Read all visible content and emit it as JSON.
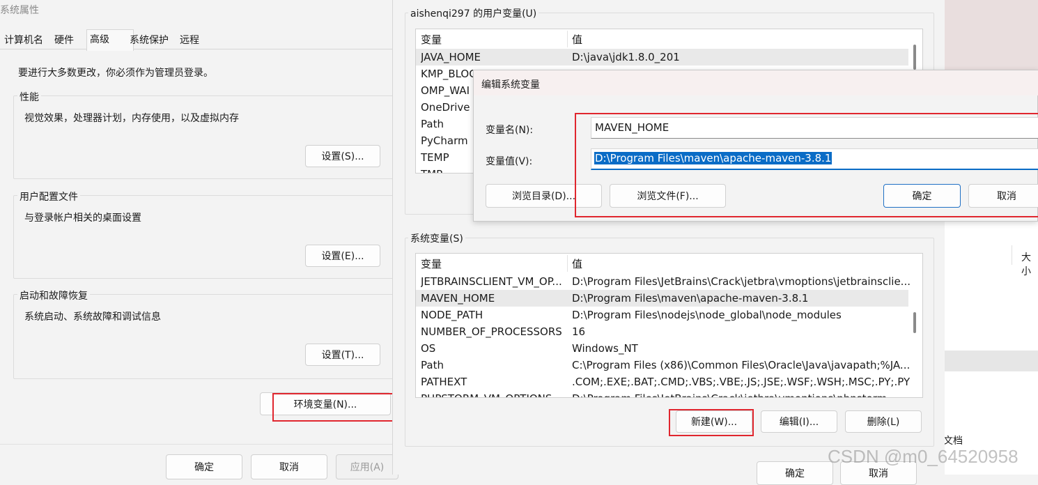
{
  "sys_props": {
    "title": "系统属性",
    "tabs": [
      "计算机名",
      "硬件",
      "高级",
      "系统保护",
      "远程"
    ],
    "admin_note": "要进行大多数更改，你必须作为管理员登录。",
    "performance": {
      "title": "性能",
      "desc": "视觉效果，处理器计划，内存使用，以及虚拟内存",
      "button": "设置(S)..."
    },
    "profiles": {
      "title": "用户配置文件",
      "desc": "与登录帐户相关的桌面设置",
      "button": "设置(E)..."
    },
    "startup": {
      "title": "启动和故障恢复",
      "desc": "系统启动、系统故障和调试信息",
      "button": "设置(T)..."
    },
    "env_button": "环境变量(N)...",
    "ok": "确定",
    "cancel": "取消",
    "apply": "应用(A)"
  },
  "env_vars": {
    "user_section": "aishenqi297 的用户变量(U)",
    "columns": {
      "name": "变量",
      "value": "值"
    },
    "user_rows": [
      {
        "name": "JAVA_HOME",
        "value": "D:\\java\\jdk1.8.0_201"
      },
      {
        "name": "KMP_BLOC",
        "value": ""
      },
      {
        "name": "OMP_WAI",
        "value": ""
      },
      {
        "name": "OneDrive",
        "value": ""
      },
      {
        "name": "Path",
        "value": ""
      },
      {
        "name": "PyCharm",
        "value": ""
      },
      {
        "name": "TEMP",
        "value": ""
      },
      {
        "name": "TMP",
        "value": ""
      }
    ],
    "system_section": "系统变量(S)",
    "system_rows": [
      {
        "name": "JETBRAINSCLIENT_VM_OP...",
        "value": "D:\\Program Files\\JetBrains\\Crack\\jetbra\\vmoptions\\jetbrainsclie..."
      },
      {
        "name": "MAVEN_HOME",
        "value": "D:\\Program Files\\maven\\apache-maven-3.8.1"
      },
      {
        "name": "NODE_PATH",
        "value": "D:\\Program Files\\nodejs\\node_global\\node_modules"
      },
      {
        "name": "NUMBER_OF_PROCESSORS",
        "value": "16"
      },
      {
        "name": "OS",
        "value": "Windows_NT"
      },
      {
        "name": "Path",
        "value": "C:\\Program Files (x86)\\Common Files\\Oracle\\Java\\javapath;%JA..."
      },
      {
        "name": "PATHEXT",
        "value": ".COM;.EXE;.BAT;.CMD;.VBS;.VBE;.JS;.JSE;.WSF;.WSH;.MSC;.PY;.PYW"
      },
      {
        "name": "PHPSTORM_VM_OPTIONS",
        "value": "D:\\Program Files\\JetBrains\\Crack\\jetbra\\vmoptions\\phpstorm..."
      }
    ],
    "new_button": "新建(W)...",
    "edit_button": "编辑(I)...",
    "delete_button": "删除(L)",
    "ok": "确定",
    "cancel": "取消"
  },
  "edit_dialog": {
    "title": "编辑系统变量",
    "name_label": "变量名(N):",
    "name_value": "MAVEN_HOME",
    "value_label": "变量值(V):",
    "value_value": "D:\\Program Files\\maven\\apache-maven-3.8.1",
    "browse_dir": "浏览目录(D)...",
    "browse_file": "浏览文件(F)...",
    "ok": "确定",
    "cancel": "取消"
  },
  "background_window": {
    "col_size": "大小",
    "doc_label": "文档"
  },
  "watermark": "CSDN @m0_64520958",
  "colors": {
    "highlight_border": "#e0262e",
    "selection": "#0a6cc6",
    "primary_border": "#1e6fc4"
  }
}
